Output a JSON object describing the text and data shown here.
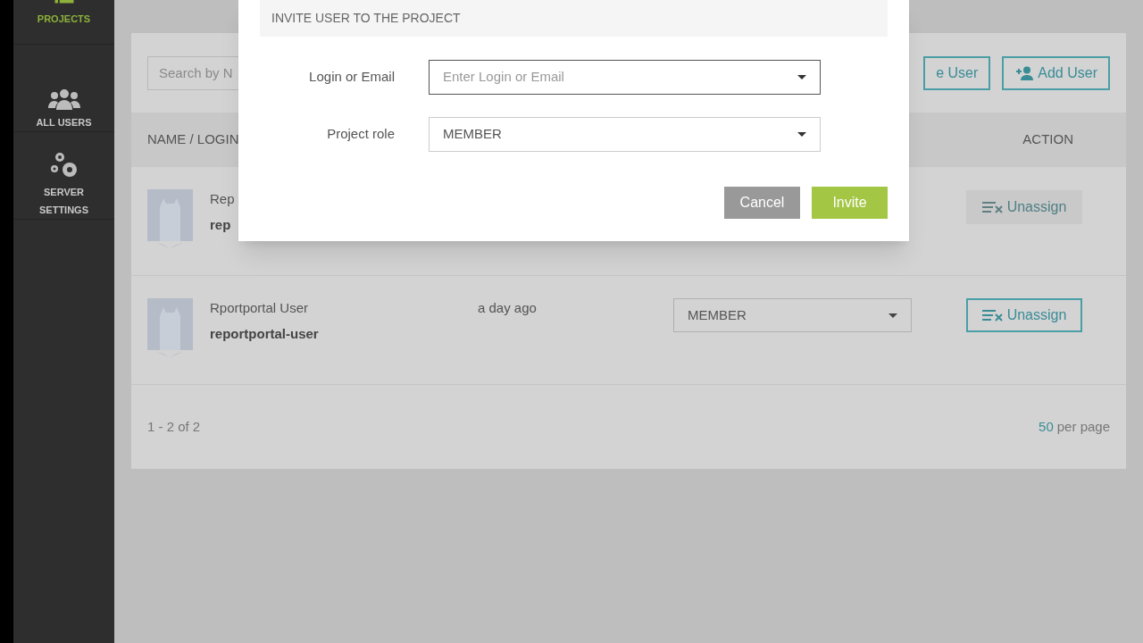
{
  "sidebar": {
    "items": [
      {
        "label": "PROJECTS",
        "kind": "list",
        "selected": true
      },
      {
        "label": "ALL USERS",
        "kind": "users",
        "selected": false
      },
      {
        "label": "SERVER SETTINGS",
        "kind": "gears",
        "selected": false
      }
    ]
  },
  "toolbar": {
    "search": {
      "placeholder": "Search by N"
    },
    "buttons": [
      {
        "label": "e User",
        "kind": "plain"
      },
      {
        "label": "Add User",
        "kind": "add"
      }
    ]
  },
  "table": {
    "columns": [
      "NAME / LOGIN",
      "ACTION"
    ],
    "rows": [
      {
        "name": "Rep",
        "login": "rep",
        "action": "Unassign",
        "disabled": true
      },
      {
        "name": "Rportportal User",
        "login": "reportportal-user",
        "date": "a day ago",
        "role": "MEMBER",
        "action": "Unassign",
        "disabled": false
      }
    ]
  },
  "pagination": {
    "range": "1 - 2 of 2",
    "per_page_count": "50",
    "per_page_label": "per page"
  },
  "modal": {
    "title": "INVITE USER TO THE PROJECT",
    "fields": [
      {
        "label": "Login or Email",
        "placeholder": "Enter Login or Email",
        "focused": true
      },
      {
        "label": "Project role",
        "value": "MEMBER",
        "focused": false
      }
    ],
    "buttons": [
      {
        "label": "Cancel",
        "kind": "secondary"
      },
      {
        "label": "Invite",
        "kind": "primary"
      }
    ]
  }
}
